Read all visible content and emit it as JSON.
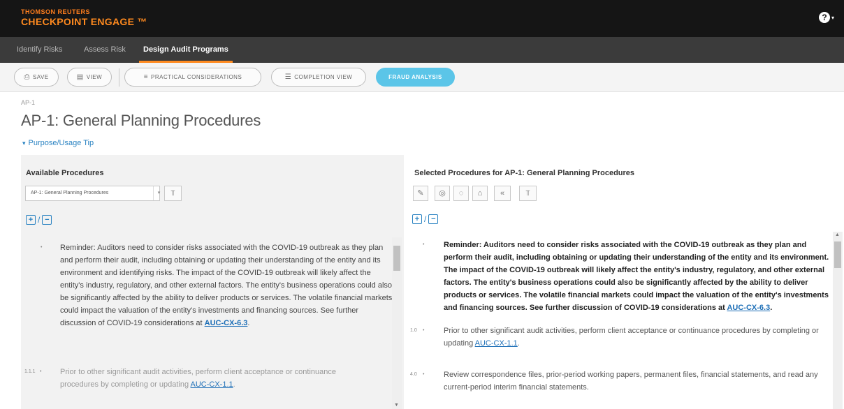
{
  "header": {
    "brand_top": "THOMSON REUTERS",
    "brand_main": "CHECKPOINT ENGAGE ™",
    "help_icon": "?",
    "help_caret": "▾"
  },
  "tabs": [
    {
      "label": "Identify Risks"
    },
    {
      "label": "Assess Risk"
    },
    {
      "label": "Design Audit Programs",
      "active": true
    }
  ],
  "toolbar": {
    "save": "SAVE",
    "view": "VIEW",
    "practical": "PRACTICAL CONSIDERATIONS",
    "completion": "COMPLETION VIEW",
    "fraud": "FRAUD ANALYSIS"
  },
  "page": {
    "breadcrumb": "AP-1",
    "title": "AP-1: General Planning Procedures",
    "tip": "Purpose/Usage Tip"
  },
  "left": {
    "heading": "Available Procedures",
    "dropdown_value": "AP-1: General Planning Procedures",
    "items": [
      {
        "num": "",
        "bullet": "•",
        "text": "Reminder: Auditors need to consider risks associated with the COVID-19 outbreak as they plan and perform their audit, including obtaining or updating their understanding of the entity and its environment and identifying risks. The impact of the COVID-19 outbreak will likely affect the entity's industry, regulatory, and other external factors. The entity's business operations could also be significantly affected by the ability to deliver products or services. The volatile financial markets could impact the valuation of the entity's investments and financing sources. See further discussion of COVID-19 considerations at ",
        "link": "AUC-CX-6.3",
        "after": "."
      },
      {
        "num": "1.1.1",
        "bullet": "•",
        "text": "Prior to other significant audit activities, perform client acceptance or continuance procedures by completing or updating ",
        "link": "AUC-CX-1.1",
        "after": "."
      }
    ]
  },
  "right": {
    "heading": "Selected Procedures for AP-1: General Planning Procedures",
    "items": [
      {
        "num": "",
        "bullet": "•",
        "text": "Reminder: Auditors need to consider risks associated with the COVID-19 outbreak as they plan and perform their audit, including obtaining or updating their understanding of the entity and its environment. The impact of the COVID-19 outbreak will likely affect the entity's industry, regulatory, and other external factors. The entity's business operations could also be significantly affected by the ability to deliver products or services. The volatile financial markets could impact the valuation of the entity's investments and financing sources. See further discussion of COVID-19 considerations at ",
        "link": "AUC-CX-6.3",
        "after": "."
      },
      {
        "num": "1.0",
        "bullet": "•",
        "text": "Prior to other significant audit activities, perform client acceptance or continuance procedures by completing or updating ",
        "link": "AUC-CX-1.1",
        "after": "."
      },
      {
        "num": "4.0",
        "bullet": "•",
        "text": "Review correspondence files, prior-period working papers, permanent files, financial statements, and read any current-period interim financial statements.",
        "link": "",
        "after": ""
      }
    ]
  }
}
